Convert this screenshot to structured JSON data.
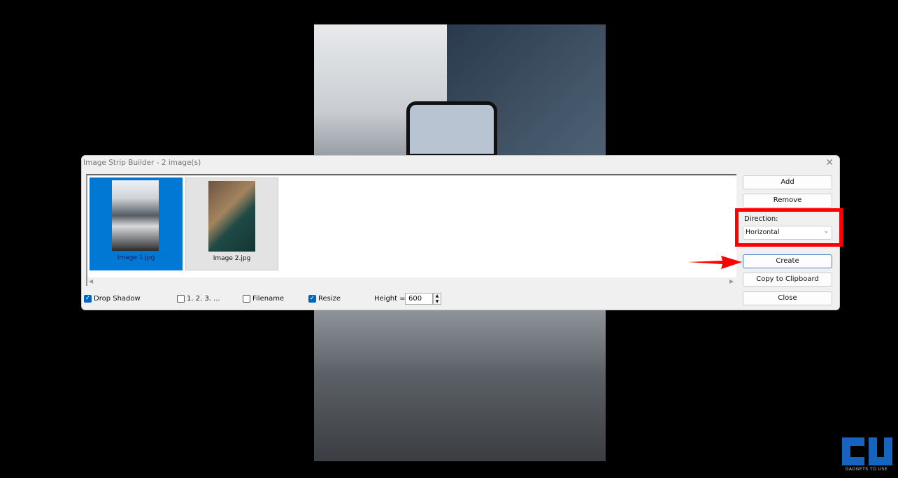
{
  "dialog": {
    "title": "Image Strip Builder  -  2 image(s)",
    "close_glyph": "✕"
  },
  "images": [
    {
      "label": "Image 1.jpg",
      "selected": true
    },
    {
      "label": "Image 2.jpg",
      "selected": false
    }
  ],
  "options": {
    "drop_shadow": {
      "label": "Drop Shadow",
      "checked": true
    },
    "numbering": {
      "label": "1. 2. 3. ...",
      "checked": false
    },
    "filename": {
      "label": "Filename",
      "checked": false
    },
    "resize": {
      "label": "Resize",
      "checked": true
    },
    "height_label": "Height =",
    "height_value": "600"
  },
  "buttons": {
    "add": "Add",
    "remove": "Remove",
    "create": "Create",
    "copy": "Copy to Clipboard",
    "close": "Close"
  },
  "direction": {
    "label": "Direction:",
    "value": "Horizontal"
  },
  "annotation": {
    "highlight_color": "#ff0000"
  },
  "watermark": {
    "text": "GADGETS TO USE",
    "brand_color": "#1565c0"
  }
}
